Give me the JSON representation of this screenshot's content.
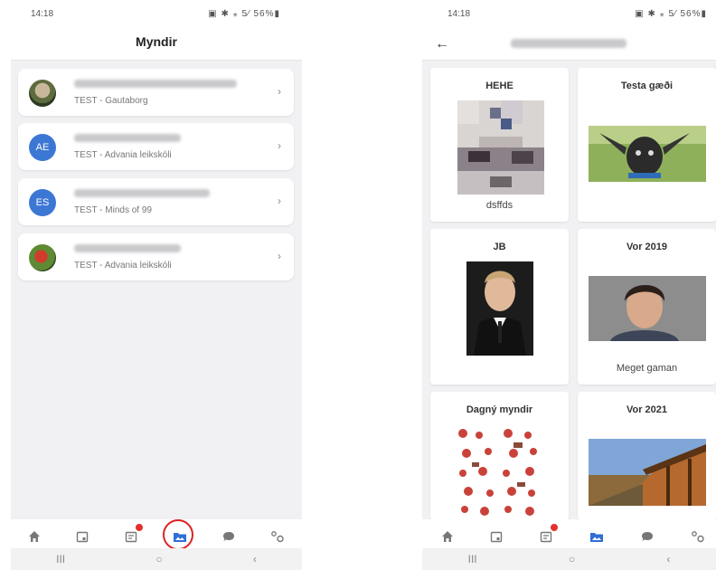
{
  "left": {
    "status": {
      "time": "14:18",
      "icons": "▣ ✱ ⁎ 5⁄ 56%▮"
    },
    "title": "Myndir",
    "items": [
      {
        "avatar": "photo",
        "subtitle": "TEST - Gautaborg"
      },
      {
        "avatar": "initials",
        "initials": "AE",
        "subtitle": "TEST - Advania leikskóli"
      },
      {
        "avatar": "initials",
        "initials": "ES",
        "subtitle": "TEST - Minds of 99"
      },
      {
        "avatar": "photo",
        "subtitle": "TEST - Advania leikskóli"
      }
    ],
    "nav": [
      "home-icon",
      "calendar-icon",
      "messages-board-icon",
      "photos-icon",
      "chat-icon",
      "settings-icon"
    ],
    "active_nav": "photos-icon",
    "sysnav": [
      "III",
      "○",
      "‹"
    ]
  },
  "right": {
    "status": {
      "time": "14:18",
      "icons": "▣ ✱ ⁎ 5⁄ 56%▮"
    },
    "albums": [
      {
        "title": "HEHE",
        "caption": "dsffds"
      },
      {
        "title": "Testa gæði",
        "caption": ""
      },
      {
        "title": "JB",
        "caption": ""
      },
      {
        "title": "Vor 2019",
        "caption": "Meget gaman"
      },
      {
        "title": "Dagný myndir",
        "caption": ""
      },
      {
        "title": "Vor 2021",
        "caption": ""
      }
    ],
    "sysnav": [
      "III",
      "○",
      "‹"
    ]
  },
  "colors": {
    "accent": "#2f6fd6",
    "avatar_blue": "#3d77d4",
    "badge_red": "#e53030",
    "background": "#f1f1f3"
  }
}
